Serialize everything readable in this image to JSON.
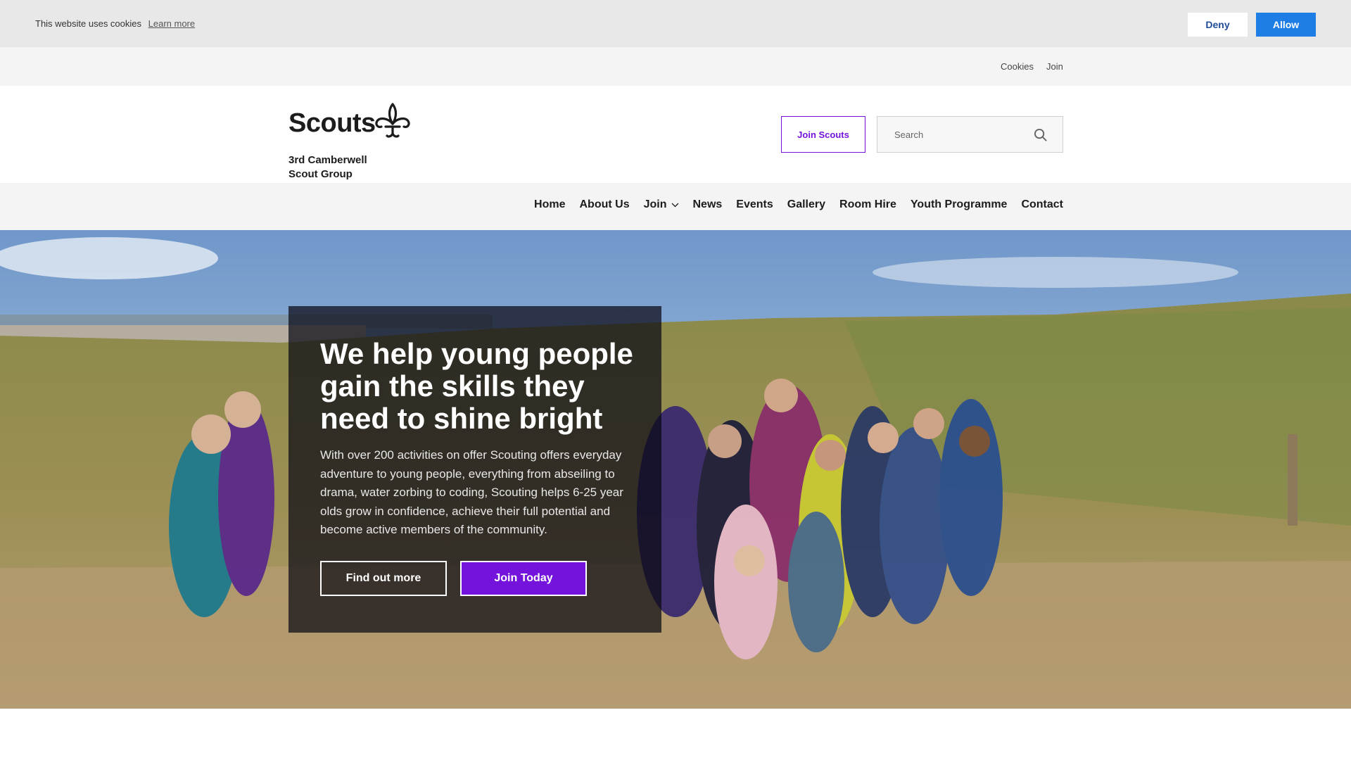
{
  "cookie_bar": {
    "message": "This website uses cookies",
    "learn_more": "Learn more",
    "deny": "Deny",
    "allow": "Allow"
  },
  "utility_nav": {
    "items": [
      "Cookies",
      "Join"
    ]
  },
  "header": {
    "logo_word": "Scouts",
    "group_line1": "3rd Camberwell",
    "group_line2": "Scout Group",
    "join_button": "Join Scouts",
    "search_placeholder": "Search"
  },
  "main_nav": {
    "items": [
      {
        "label": "Home"
      },
      {
        "label": "About Us"
      },
      {
        "label": "Join",
        "has_dropdown": true
      },
      {
        "label": "News"
      },
      {
        "label": "Events"
      },
      {
        "label": "Gallery"
      },
      {
        "label": "Room Hire"
      },
      {
        "label": "Youth Programme"
      },
      {
        "label": "Contact"
      }
    ]
  },
  "hero": {
    "title": "We help young people gain the skills they need to shine bright",
    "body": "With over 200 activities on offer Scouting offers everyday adventure to young people, everything from abseiling to drama, water zorbing to coding, Scouting helps 6-25 year olds grow in confidence, achieve their full potential and become active members of the community.",
    "primary_button": "Find out more",
    "secondary_button": "Join Today"
  },
  "colors": {
    "brand_purple": "#7413dc",
    "allow_blue": "#1e7ee6",
    "cookie_bar_bg": "#e8e8e8",
    "nav_bg": "#f4f4f4"
  }
}
